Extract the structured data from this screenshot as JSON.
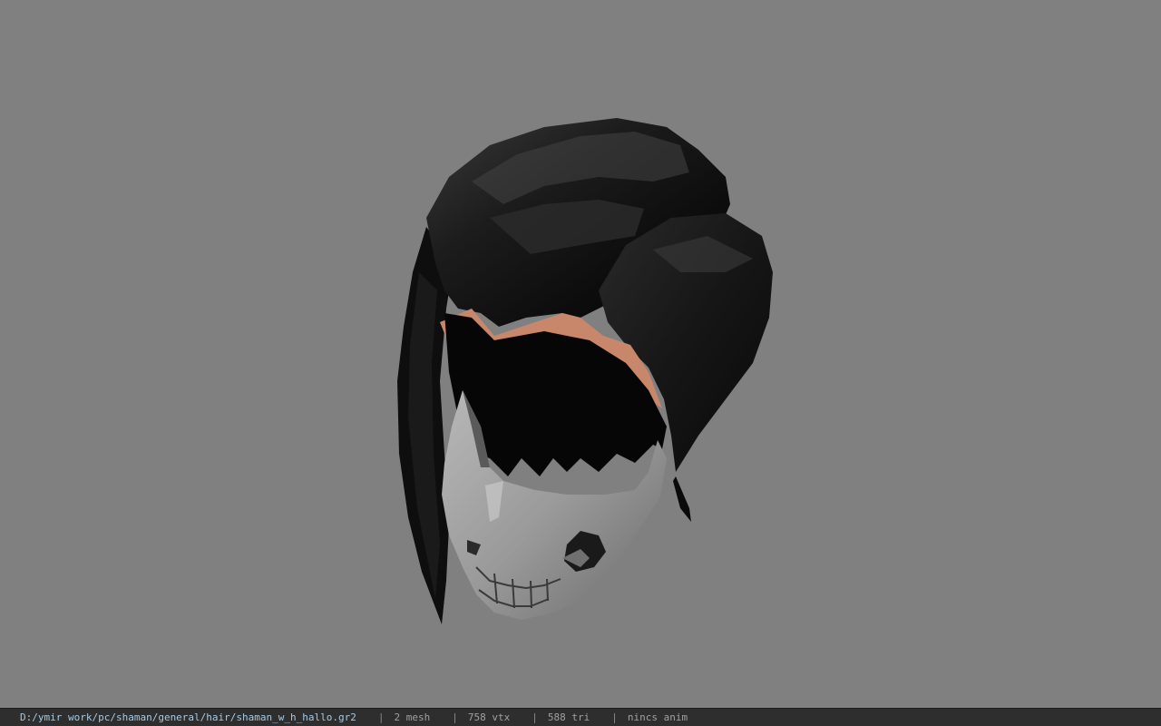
{
  "viewer": {
    "background_color": "#808080",
    "model_name": "hair-with-skull-mask"
  },
  "status": {
    "path": "D:/ymir work/pc/shaman/general/hair/shaman_w_h_hallo.gr2",
    "separator": "|",
    "mesh": "2 mesh",
    "vtx": "758 vtx",
    "tri": "588 tri",
    "anim": "nincs anim"
  }
}
